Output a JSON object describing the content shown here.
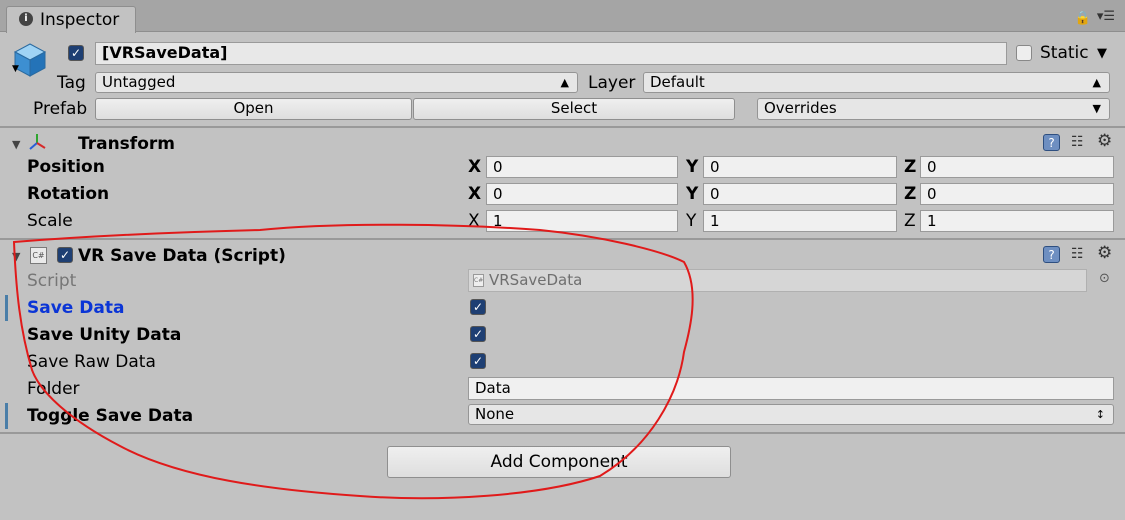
{
  "tab": {
    "title": "Inspector",
    "icon": "i"
  },
  "header": {
    "object_name": "[VRSaveData]",
    "static_label": "Static",
    "tag_label": "Tag",
    "tag_value": "Untagged",
    "layer_label": "Layer",
    "layer_value": "Default",
    "prefab_label": "Prefab",
    "open_label": "Open",
    "select_label": "Select",
    "overrides_label": "Overrides"
  },
  "transform": {
    "title": "Transform",
    "rows": [
      {
        "label": "Position",
        "x": "0",
        "y": "0",
        "z": "0"
      },
      {
        "label": "Rotation",
        "x": "0",
        "y": "0",
        "z": "0"
      },
      {
        "label": "Scale",
        "x": "1",
        "y": "1",
        "z": "1"
      }
    ],
    "axes": {
      "x": "X",
      "y": "Y",
      "z": "Z"
    }
  },
  "script_component": {
    "title": "VR Save Data (Script)",
    "script_label": "Script",
    "script_value": "VRSaveData",
    "cs_icon": "C#",
    "save_data_label": "Save Data",
    "save_unity_data_label": "Save Unity Data",
    "save_raw_data_label": "Save Raw Data",
    "folder_label": "Folder",
    "folder_value": "Data",
    "toggle_label": "Toggle Save Data",
    "toggle_value": "None"
  },
  "add_component_label": "Add Component",
  "help_icon": "?",
  "colors": {
    "accent_blue": "#0b35d6",
    "annotation_red": "#e01a1a"
  }
}
